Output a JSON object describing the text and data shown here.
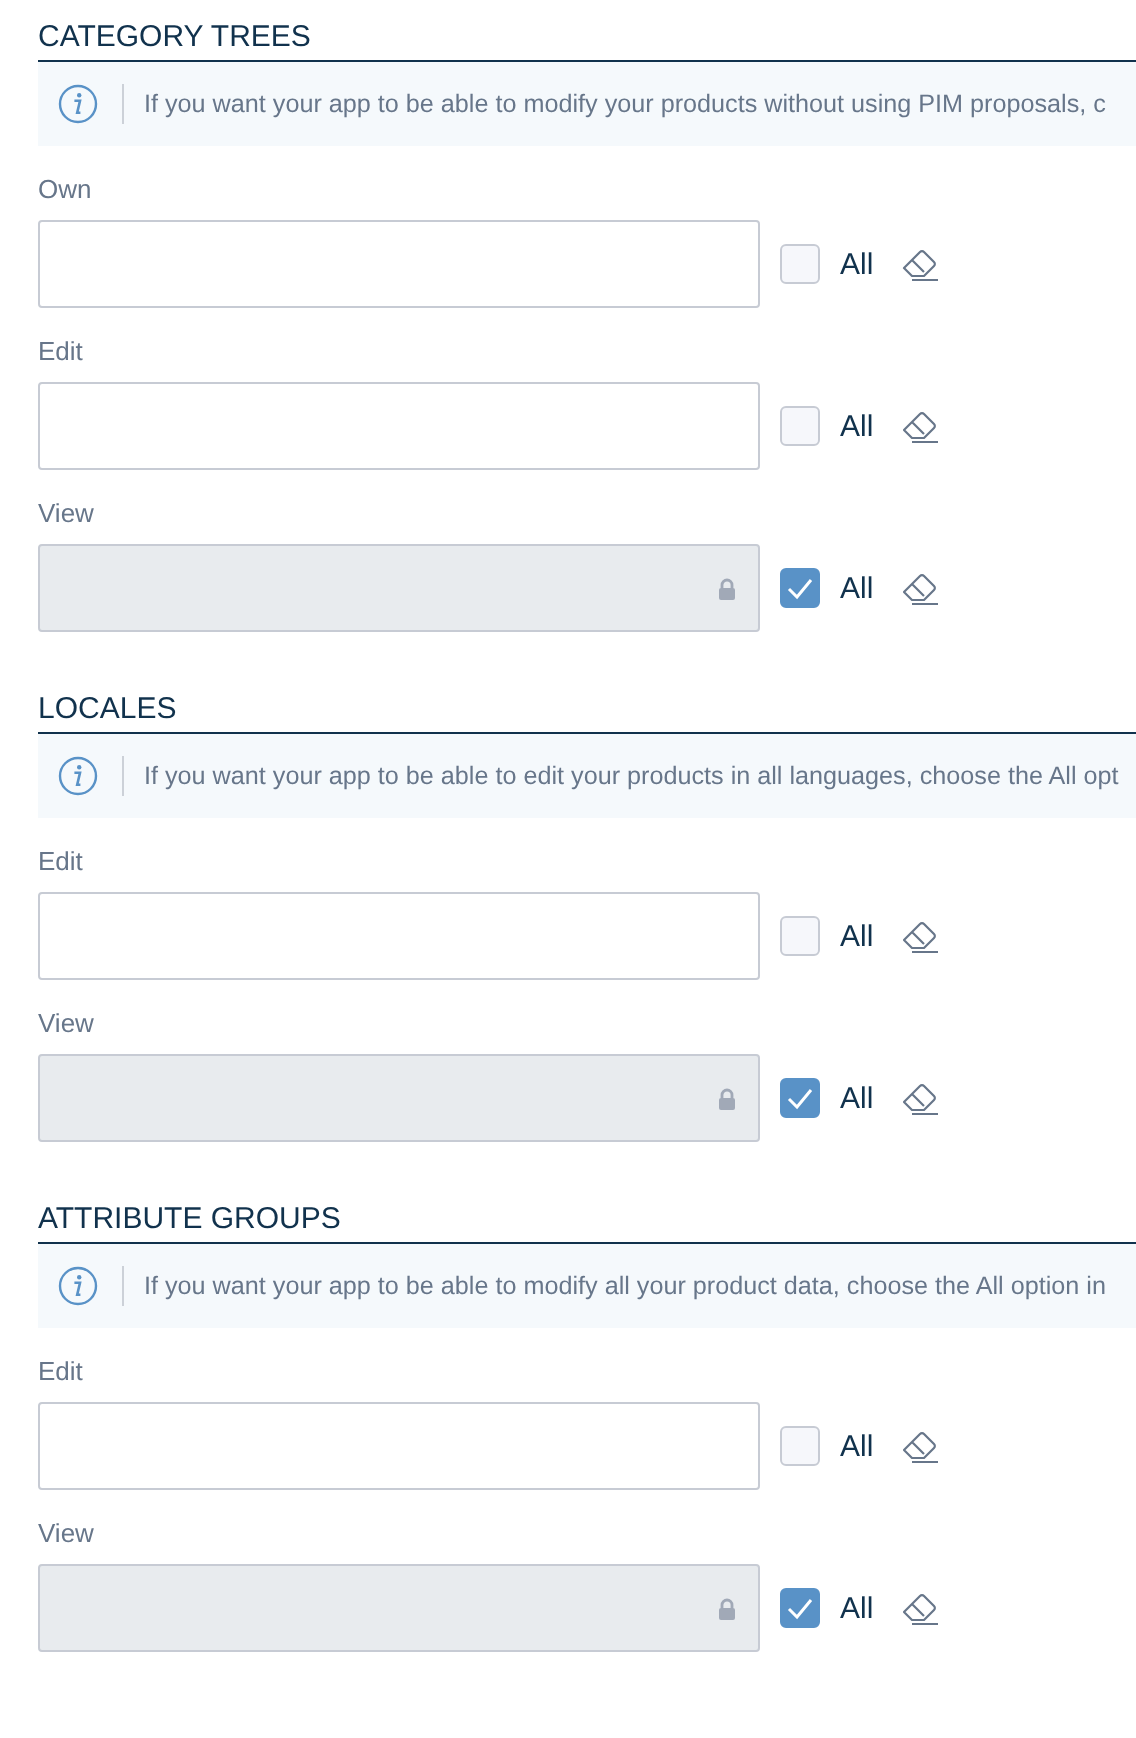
{
  "sections": [
    {
      "title": "CATEGORY TREES",
      "info": "If you want your app to be able to modify your products without using PIM proposals, c",
      "fields": [
        {
          "label": "Own",
          "locked": false,
          "all_label": "All",
          "all_checked": false
        },
        {
          "label": "Edit",
          "locked": false,
          "all_label": "All",
          "all_checked": false
        },
        {
          "label": "View",
          "locked": true,
          "all_label": "All",
          "all_checked": true
        }
      ]
    },
    {
      "title": "LOCALES",
      "info": "If you want your app to be able to edit your products in all languages, choose the All opt",
      "fields": [
        {
          "label": "Edit",
          "locked": false,
          "all_label": "All",
          "all_checked": false
        },
        {
          "label": "View",
          "locked": true,
          "all_label": "All",
          "all_checked": true
        }
      ]
    },
    {
      "title": "ATTRIBUTE GROUPS",
      "info": "If you want your app to be able to modify all your product data, choose the All option in",
      "fields": [
        {
          "label": "Edit",
          "locked": false,
          "all_label": "All",
          "all_checked": false
        },
        {
          "label": "View",
          "locked": true,
          "all_label": "All",
          "all_checked": true
        }
      ]
    }
  ]
}
